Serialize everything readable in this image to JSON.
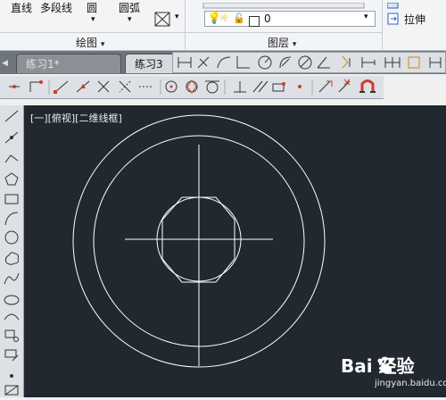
{
  "ribbon": {
    "draw_panel": {
      "line_label": "直线",
      "polyline_label": "多段线",
      "circle_label": "圆",
      "arc_label": "圆弧",
      "title": "绘图"
    },
    "layers_panel": {
      "current_layer": "0",
      "title": "图层"
    },
    "right_panel": {
      "stretch_label": "拉伸"
    }
  },
  "tabs": [
    {
      "label": "练习1*"
    },
    {
      "label": "练习3"
    }
  ],
  "viewport": {
    "label": "[一][俯视][二维线框]"
  },
  "watermark": {
    "brand_text": "Bai 经验",
    "url": "jingyan.baidu.com"
  },
  "colors": {
    "canvas_bg": "#212830",
    "drawing_stroke": "#ffffff",
    "accent_red": "#d03a2e",
    "tool_blue": "#2c62b8"
  }
}
